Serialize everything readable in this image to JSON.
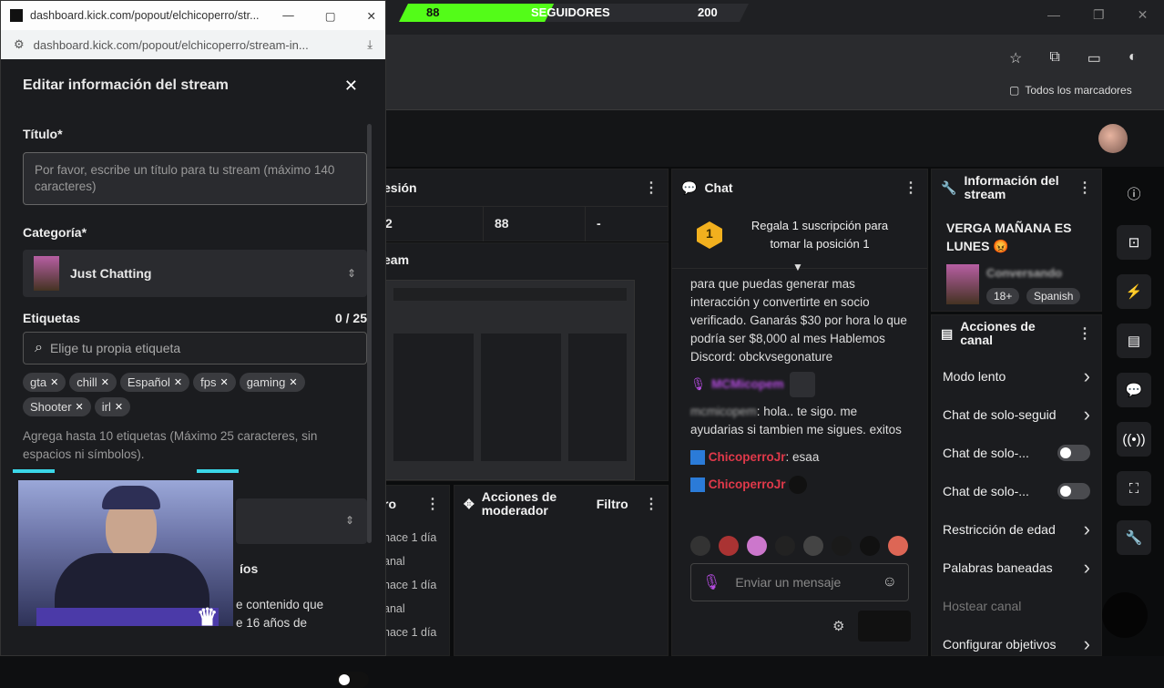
{
  "popout": {
    "window_title": "dashboard.kick.com/popout/elchicoperro/str...",
    "url": "dashboard.kick.com/popout/elchicoperro/stream-in...",
    "heading": "Editar información del stream",
    "title_label": "Título*",
    "title_placeholder": "Por favor, escribe un título para tu stream (máximo 140 caracteres)",
    "category_label": "Categoría*",
    "category_value": "Just Chatting",
    "tags_label": "Etiquetas",
    "tags_count": "0 / 25",
    "tags_placeholder": "Elige tu propia etiqueta",
    "tags": [
      "gta",
      "chill",
      "Español",
      "fps",
      "gaming",
      "Shooter",
      "irl"
    ],
    "tags_hint": "Agrega hasta 10 etiquetas (Máximo 25 caracteres, sin espacios ni símbolos).",
    "partial_label": "íos",
    "partial_text1": "e contenido que",
    "partial_text2": "e 16 años de"
  },
  "follower_bar": {
    "left": "88",
    "label": "SEGUIDORES",
    "right": "200",
    "progress": 0.44
  },
  "browser": {
    "bookmarks": "Todos los marcadores"
  },
  "session_panel": {
    "title": "esión",
    "stat1": "2",
    "stat2": "88",
    "stat3": "-",
    "sub_title": "eam"
  },
  "mod_panel": {
    "left_title": "ro",
    "title": "Acciones de moderador",
    "filter": "Filtro",
    "items": [
      "hace 1 día",
      "anal",
      "hace 1 día",
      "anal",
      "hace 1 día"
    ]
  },
  "chat": {
    "title": "Chat",
    "promo_rank": "1",
    "promo_text": "Regala 1 suscripción para tomar la posición 1",
    "msg1": "para que puedas generar mas interacción y convertirte en socio verificado. Ganarás $30 por hora lo que podría ser $8,000 al mes Hablemos Discord: obckvsegonature",
    "user1": "MCMicopem",
    "user1b": "mcmicopem",
    "msg2": ": hola.. te sigo. me ayudarias si tambien me sigues. exitos",
    "user2": "ChicoperroJr",
    "msg3": ": esaa",
    "user3": "ChicoperroJr",
    "placeholder": "Enviar un mensaje"
  },
  "stream_info": {
    "title": "Información del stream",
    "stream_title": "VERGA MAÑANA ES LUNES 😡",
    "category": "Conversando",
    "badge_age": "18+",
    "badge_lang": "Spanish"
  },
  "channel_actions": {
    "title": "Acciones de canal",
    "items": [
      {
        "label": "Modo lento",
        "kind": "chevron"
      },
      {
        "label": "Chat de solo-seguid",
        "kind": "chevron"
      },
      {
        "label": "Chat de solo-...",
        "kind": "toggle"
      },
      {
        "label": "Chat de solo-...",
        "kind": "toggle"
      },
      {
        "label": "Restricción de edad",
        "kind": "chevron"
      },
      {
        "label": "Palabras baneadas",
        "kind": "chevron"
      },
      {
        "label": "Hostear canal",
        "kind": "disabled"
      },
      {
        "label": "Configurar objetivos",
        "kind": "chevron"
      }
    ]
  },
  "colors": {
    "accent": "#53fc18",
    "panel": "#1b1c1f",
    "username": "#e0394a"
  }
}
